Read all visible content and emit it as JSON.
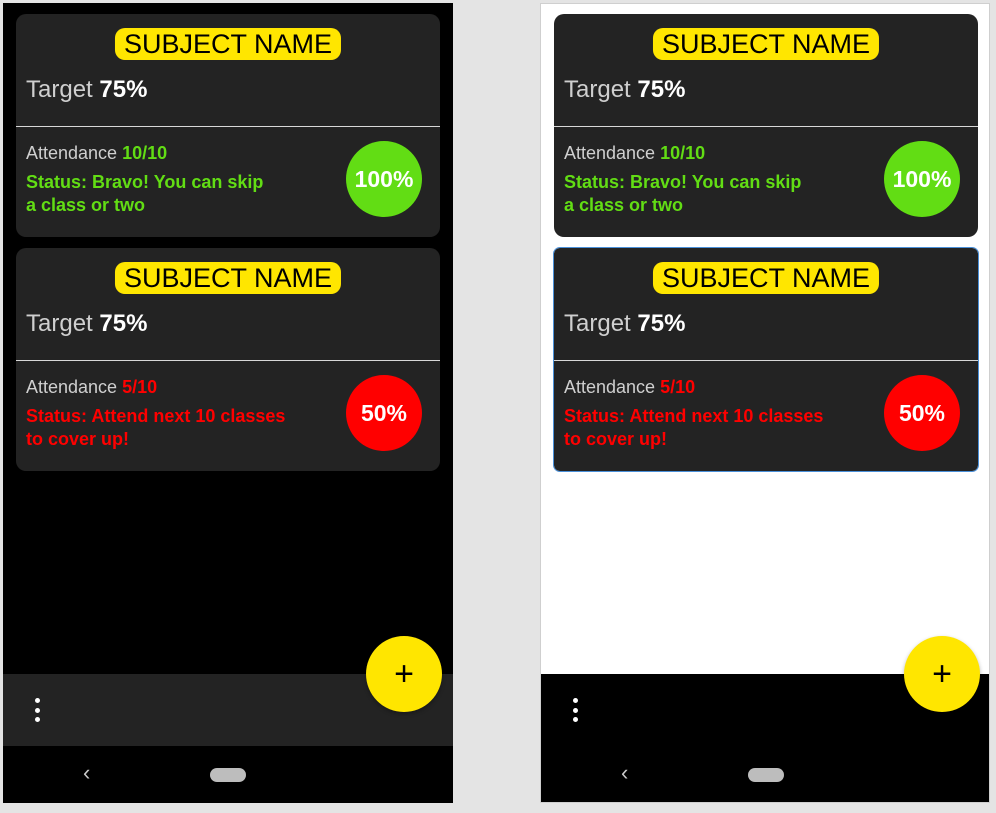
{
  "colors": {
    "accent": "#ffe600",
    "good": "#62dd14",
    "bad": "#ff0000",
    "card": "#232323"
  },
  "cards": [
    {
      "subject": "SUBJECT NAME",
      "target_label": "Target",
      "target_value": "75%",
      "attendance_label": "Attendance",
      "attendance_value": "10/10",
      "status_line1": "Status: Bravo! You can skip",
      "status_line2": "a class or two",
      "percent": "100%",
      "state": "good"
    },
    {
      "subject": "SUBJECT NAME",
      "target_label": "Target",
      "target_value": "75%",
      "attendance_label": "Attendance",
      "attendance_value": "5/10",
      "status_line1": "Status: Attend next 10 classes",
      "status_line2": "to cover up!",
      "percent": "50%",
      "state": "bad"
    }
  ],
  "fab": {
    "label": "+"
  },
  "nav": {
    "back_glyph": "‹"
  },
  "icons": {
    "menu": "more-vert-icon",
    "add": "plus-icon",
    "back": "back-icon",
    "home": "home-pill-icon"
  }
}
